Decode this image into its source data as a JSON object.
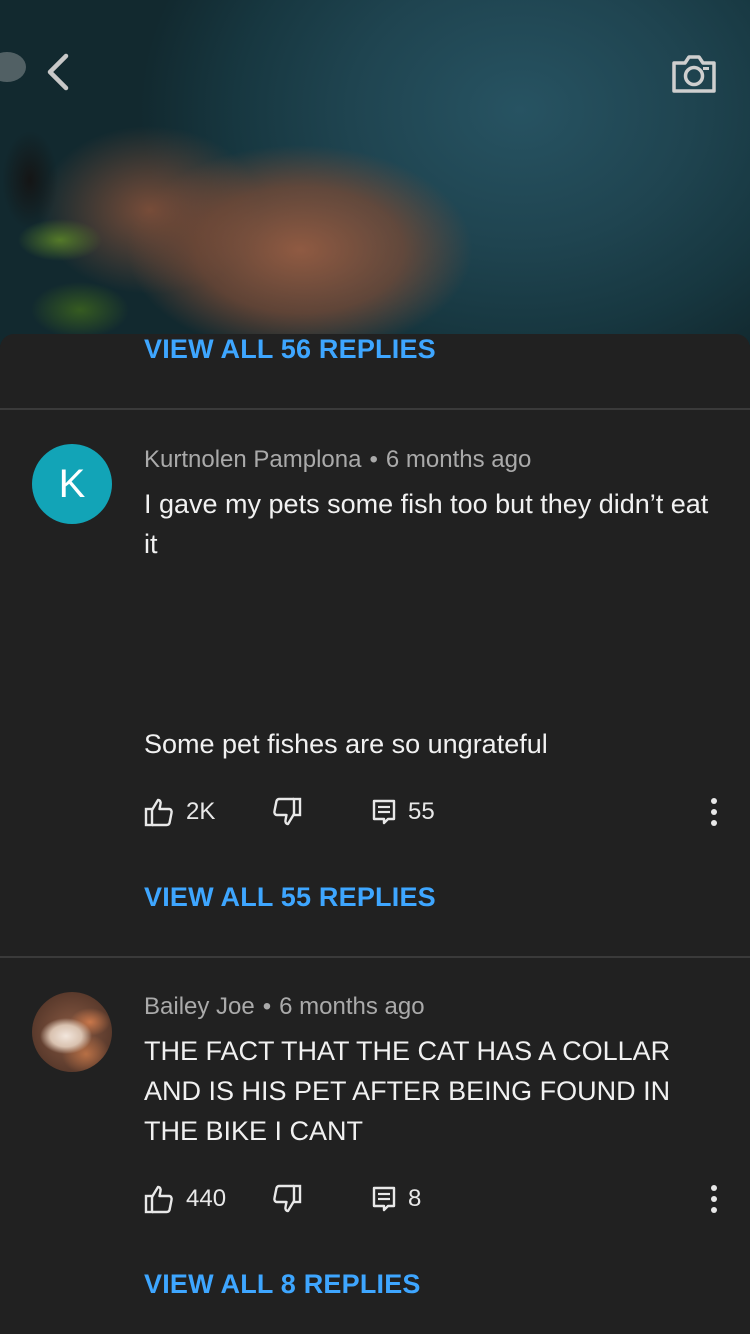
{
  "header": {
    "back_icon": "chevron-left-icon",
    "camera_icon": "camera-icon"
  },
  "thread_top": {
    "view_replies_label": "VIEW ALL 56 REPLIES"
  },
  "comments": [
    {
      "avatar_letter": "K",
      "author": "Kurtnolen Pamplona",
      "separator": "•",
      "time": "6 months ago",
      "text_part1": "I gave my pets some fish too but they didn’t eat it",
      "text_part2": "Some pet fishes are so ungrateful",
      "likes": "2K",
      "replies": "55",
      "view_replies_label": "VIEW ALL 55 REPLIES"
    },
    {
      "author": "Bailey Joe",
      "separator": "•",
      "time": "6 months ago",
      "text_part1": "THE FACT THAT THE CAT HAS A COLLAR AND IS HIS PET AFTER BEING FOUND IN THE BIKE I CANT",
      "likes": "440",
      "replies": "8",
      "view_replies_label": "VIEW ALL 8 REPLIES"
    }
  ],
  "colors": {
    "background": "#212121",
    "link": "#3ea6ff",
    "avatar_k": "#12a4b7",
    "meta_text": "#aaaaaa"
  }
}
